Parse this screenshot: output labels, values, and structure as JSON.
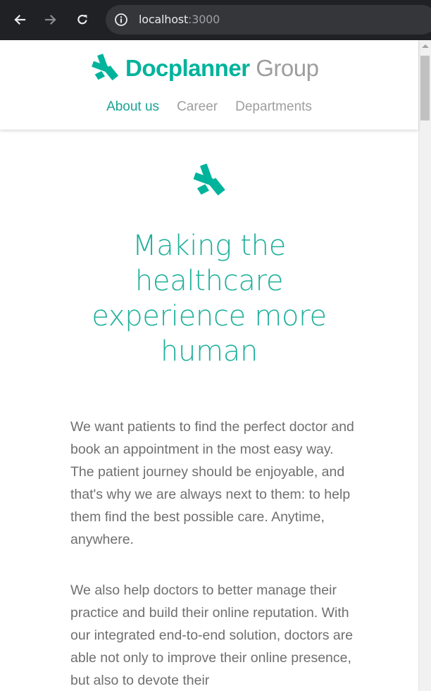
{
  "browser": {
    "url_host": "localhost",
    "url_port": ":3000"
  },
  "header": {
    "logo_primary": "Docplanner",
    "logo_secondary": " Group",
    "nav": [
      {
        "label": "About us",
        "active": true
      },
      {
        "label": "Career",
        "active": false
      },
      {
        "label": "Departments",
        "active": false
      }
    ]
  },
  "hero": {
    "headline": "Making the healthcare experience more human"
  },
  "body": {
    "paragraphs": [
      "We want patients to find the perfect doctor and book an appointment in the most easy way. The patient journey should be enjoyable, and that's why we are always next to them: to help them find the best possible care. Anytime, anywhere.",
      "We also help doctors to better manage their practice and build their online reputation. With our integrated end-to-end solution, doctors are able not only to improve their online presence, but also to devote their"
    ]
  },
  "colors": {
    "brand_teal": "#00b39b",
    "nav_active": "#19a393",
    "nav_inactive": "#9e9e9e",
    "body_text": "#6f6f6f"
  },
  "icons": {
    "back": "arrow-left-icon",
    "forward": "arrow-right-icon",
    "reload": "reload-icon",
    "site_info": "info-icon",
    "logo": "docplanner-star-icon"
  }
}
